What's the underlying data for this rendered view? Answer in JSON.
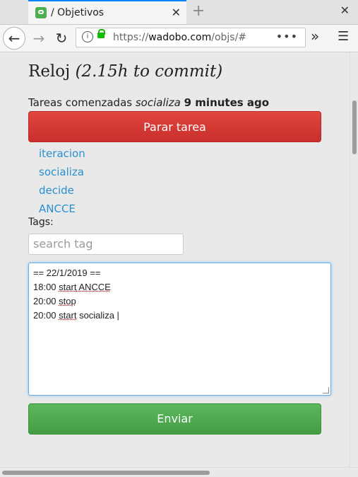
{
  "tab": {
    "title": "/ Objetivos"
  },
  "nav": {
    "url_prefix": "https://",
    "url_host": "wadobo.com",
    "url_path": "/objs/#"
  },
  "page": {
    "heading": "Reloj",
    "heading_commit": "(2.15h to commit)",
    "started_prefix": "Tareas comenzadas",
    "started_task": "socializa",
    "started_time": "9 minutes ago",
    "stop_button": "Parar tarea",
    "tags": [
      "iteracion",
      "socializa",
      "decide",
      "ANCCE"
    ],
    "tags_label": "Tags:",
    "search_placeholder": "search tag",
    "editor_lines": [
      {
        "time": "== 22/1/2019 ==",
        "kw": "",
        "rest": ""
      },
      {
        "time": "18:00 ",
        "kw": "start",
        "rest": " ANCCE"
      },
      {
        "time": "20:00 ",
        "kw": "stop",
        "rest": ""
      },
      {
        "time": "20:00 ",
        "kw": "start",
        "rest": " socializa |"
      }
    ],
    "send_button": "Enviar"
  }
}
